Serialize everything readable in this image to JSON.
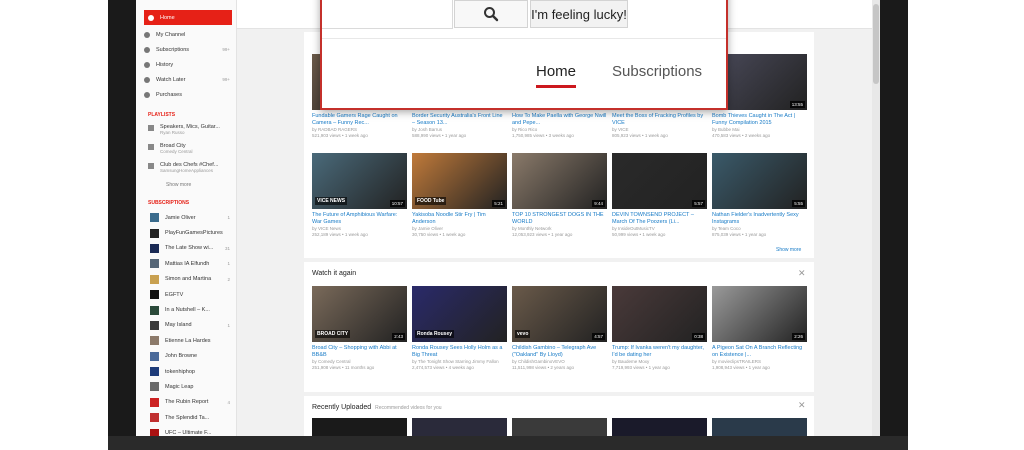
{
  "sidebar": {
    "nav": [
      {
        "label": "Home",
        "count": "",
        "active": true
      },
      {
        "label": "My Channel",
        "count": ""
      },
      {
        "label": "Subscriptions",
        "count": "99+"
      },
      {
        "label": "History",
        "count": ""
      },
      {
        "label": "Watch Later",
        "count": "99+"
      },
      {
        "label": "Purchases",
        "count": ""
      }
    ],
    "playlists_heading": "PLAYLISTS",
    "playlists": [
      {
        "title": "Speakers, Mics, Guitar...",
        "sub": "Ryan Russo"
      },
      {
        "title": "Broad City",
        "sub": "Comedy Central"
      },
      {
        "title": "Club des Chefs #Chef...",
        "sub": "SamsungHomeAppliances"
      }
    ],
    "show_more": "Show more",
    "subscriptions_heading": "SUBSCRIPTIONS",
    "subscriptions": [
      {
        "name": "Jamie Oliver",
        "count": "1",
        "color": "#3a6b8c"
      },
      {
        "name": "PlayFunGamesPictures",
        "count": "",
        "color": "#222222"
      },
      {
        "name": "The Late Show wi...",
        "count": "31",
        "color": "#1a2a55"
      },
      {
        "name": "Mattias IA Elfundh",
        "count": "1",
        "color": "#556677"
      },
      {
        "name": "Simon and Martina",
        "count": "2",
        "color": "#c8a050"
      },
      {
        "name": "EGFTV",
        "count": "",
        "color": "#111111"
      },
      {
        "name": "In a Nutshell – K...",
        "count": "",
        "color": "#2b4a3a"
      },
      {
        "name": "May Island",
        "count": "1",
        "color": "#3a3a3a"
      },
      {
        "name": "Etienne La Hardes",
        "count": "",
        "color": "#8c7a6a"
      },
      {
        "name": "John Browne",
        "count": "",
        "color": "#4a6a9a"
      },
      {
        "name": "tokenhiphop",
        "count": "",
        "color": "#1e3c7a"
      },
      {
        "name": "Magic Leap",
        "count": "",
        "color": "#6a6a6a"
      },
      {
        "name": "The Rubin Report",
        "count": "4",
        "color": "#cc2222"
      },
      {
        "name": "The Splendid Ta...",
        "count": "",
        "color": "#c03030"
      },
      {
        "name": "UFC – Ultimate F...",
        "count": "",
        "color": "#aa1111"
      }
    ]
  },
  "overlay": {
    "lucky_label": "I'm feeling lucky!",
    "tab_home": "Home",
    "tab_subscriptions": "Subscriptions"
  },
  "row1": [
    {
      "title": "Fundable Gamers Rage Caught on Camera – Funny Rec...",
      "channel": "by RADBAD RAGERS",
      "meta": "521,903 views • 1 week ago",
      "duration": "",
      "color": "#6b5a4a"
    },
    {
      "title": "Border Security Australia's Front Line – Season 13...",
      "channel": "by Josh Barrus",
      "meta": "588,990 views • 1 year ago",
      "duration": "",
      "color": "#7a7060"
    },
    {
      "title": "How To Make Paella with George Nwill and Pepe...",
      "channel": "by Rico Rico",
      "meta": "1,750,985 views • 3 weeks ago",
      "duration": "",
      "color": "#8a6040"
    },
    {
      "title": "Meet the Boss of Fracking Profiles by VICE",
      "channel": "by VICE",
      "meta": "805,923 views • 1 week ago",
      "duration": "",
      "color": "#5a5a5a"
    },
    {
      "title": "Bomb Thieves Caught in The Act | Funny Compilation 2015",
      "channel": "by Bubbe Mai",
      "meta": "470,583 views • 2 weeks ago",
      "duration": "13:55",
      "color": "#4a4a5a"
    }
  ],
  "row2": [
    {
      "title": "The Future of Amphibious Warfare: War Games",
      "channel": "by VICE News",
      "meta": "252,189 views • 1 week ago",
      "duration": "10:57",
      "overlay": "VICE NEWS",
      "color": "#4a6a7a"
    },
    {
      "title": "Yakisoba Noodle Stir Fry | Tim Anderson",
      "channel": "by Jamie Oliver",
      "meta": "30,750 views • 1 week ago",
      "duration": "5:21",
      "overlay": "FOOD Tube",
      "color": "#c07a3a"
    },
    {
      "title": "TOP 10 STRONGEST DOGS IN THE WORLD",
      "channel": "by Monthly Network",
      "meta": "12,053,923 views • 1 year ago",
      "duration": "9:44",
      "overlay": "",
      "color": "#8a7a6a"
    },
    {
      "title": "DEVIN TOWNSEND PROJECT – March Of The Poozers (Li...",
      "channel": "by InsideOutMusicTV",
      "meta": "50,999 views • 1 week ago",
      "duration": "5:57",
      "overlay": "",
      "color": "#2a2a2a"
    },
    {
      "title": "Nathan Fielder's Inadvertently Sexy Instagrams",
      "channel": "by Team Coco",
      "meta": "875,039 views • 1 year ago",
      "duration": "5:55",
      "overlay": "",
      "color": "#3a5a6a"
    }
  ],
  "show_more_link": "Show more",
  "watch_again_title": "Watch it again",
  "row3": [
    {
      "title": "Broad City – Shopping with Abbi at BB&B",
      "channel": "by Comedy Central",
      "meta": "251,908 views • 11 months ago",
      "duration": "2:43",
      "overlay": "BROAD CITY",
      "color": "#7a6a5a"
    },
    {
      "title": "Ronda Rousey Sees Holly Holm as a Big Threat",
      "channel": "by The Tonight Show Starring Jimmy Fallon",
      "meta": "2,474,573 views • 4 weeks ago",
      "duration": "",
      "overlay": "Ronda Rousey",
      "color": "#2a2a6a"
    },
    {
      "title": "Childish Gambino – Telegraph Ave (\"Oakland\" By Lloyd)",
      "channel": "by ChildishGambinoVEVO",
      "meta": "11,511,998 views • 2 years ago",
      "duration": "4:57",
      "overlay": "vevo",
      "color": "#6a5a4a"
    },
    {
      "title": "Trump: If Ivanka weren't my daughter, I'd be dating her",
      "channel": "by Baudeme Moxy",
      "meta": "7,719,993 views • 1 year ago",
      "duration": "0:38",
      "overlay": "",
      "color": "#4a3a3a"
    },
    {
      "title": "A Pigeon Sat On A Branch Reflecting on Existence |...",
      "channel": "by movieclipsTRAILERS",
      "meta": "1,908,943 views • 1 year ago",
      "duration": "2:26",
      "overlay": "",
      "color": "#9a9a9a"
    }
  ],
  "recent_title": "Recently Uploaded",
  "recent_sub": "Recommended videos for you",
  "row4_colors": [
    "#1a1a1a",
    "#2a2a3a",
    "#3a3a3a",
    "#1a1a2a",
    "#2a3a4a"
  ]
}
